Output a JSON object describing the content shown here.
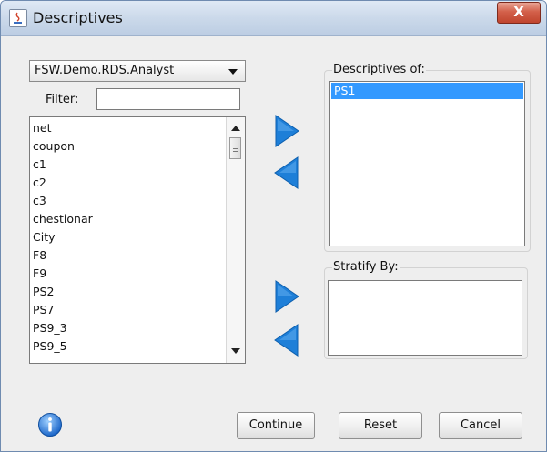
{
  "window": {
    "title": "Descriptives",
    "close_label": "X"
  },
  "dataset_select": {
    "value": "FSW.Demo.RDS.Analyst"
  },
  "filter": {
    "label": "Filter:",
    "value": ""
  },
  "variables": [
    "net",
    "coupon",
    "c1",
    "c2",
    "c3",
    "chestionar",
    "City",
    "F8",
    "F9",
    "PS2",
    "PS7",
    "PS9_3",
    "PS9_5"
  ],
  "descriptives_of": {
    "title": "Descriptives of:",
    "items": [
      "PS1"
    ]
  },
  "stratify_by": {
    "title": "Stratify By:",
    "items": []
  },
  "buttons": {
    "continue": "Continue",
    "reset": "Reset",
    "cancel": "Cancel"
  },
  "colors": {
    "arrow_blue": "#1e7fd8",
    "selection": "#3399ff",
    "close_red": "#c9503a"
  }
}
